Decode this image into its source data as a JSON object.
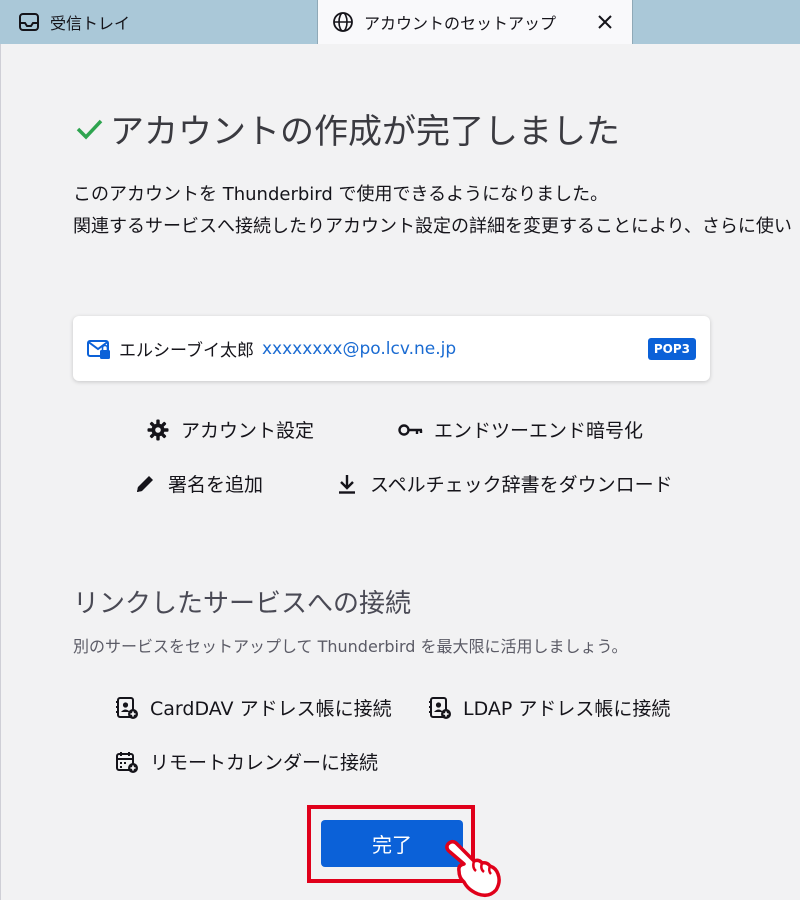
{
  "tabs": {
    "inbox_label": "受信トレイ",
    "setup_label": "アカウントのセットアップ"
  },
  "heading": {
    "title": "アカウントの作成が完了しました",
    "line1": "このアカウントを Thunderbird で使用できるようになりました。",
    "line2": "関連するサービスへ接続したりアカウント設定の詳細を変更することにより、さらに使い"
  },
  "account": {
    "name": "エルシーブイ太郎",
    "email": "xxxxxxxx@po.lcv.ne.jp",
    "protocol": "POP3"
  },
  "actions": {
    "settings": "アカウント設定",
    "e2e": "エンドツーエンド暗号化",
    "signature": "署名を追加",
    "spellcheck": "スペルチェック辞書をダウンロード"
  },
  "services": {
    "title": "リンクしたサービスへの接続",
    "description": "別のサービスをセットアップして Thunderbird を最大限に活用しましょう。",
    "carddav": "CardDAV アドレス帳に接続",
    "ldap": "LDAP アドレス帳に接続",
    "calendar": "リモートカレンダーに接続"
  },
  "done_button": "完了",
  "colors": {
    "accent": "#0b61d8",
    "check": "#2ea44f",
    "highlight": "#e0001a",
    "tabbar": "#aac8d8"
  }
}
